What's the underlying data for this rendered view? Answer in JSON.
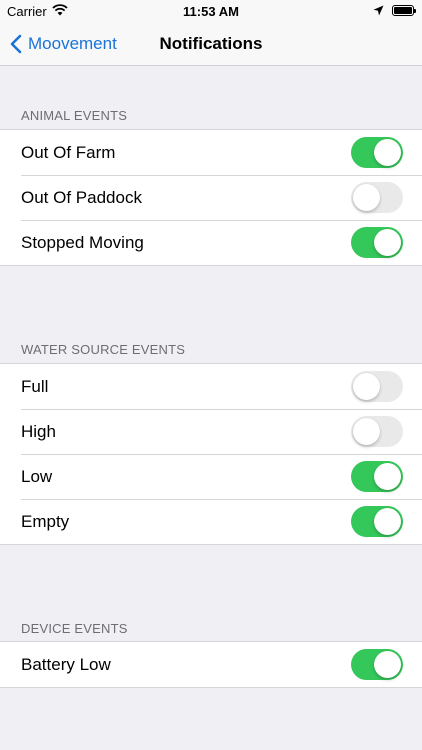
{
  "status_bar": {
    "carrier": "Carrier",
    "time": "11:53 AM",
    "wifi_icon": "wifi-icon",
    "location_icon": "location-arrow-icon",
    "battery_icon": "battery-icon"
  },
  "nav": {
    "back_label": "Moovement",
    "back_icon": "chevron-left-icon",
    "title": "Notifications",
    "accent": "#1a73d9"
  },
  "toggle_on_color": "#34c759",
  "sections": [
    {
      "header": "ANIMAL EVENTS",
      "rows": [
        {
          "label": "Out Of Farm",
          "on": true
        },
        {
          "label": "Out Of Paddock",
          "on": false
        },
        {
          "label": "Stopped Moving",
          "on": true
        }
      ]
    },
    {
      "header": "WATER SOURCE EVENTS",
      "rows": [
        {
          "label": "Full",
          "on": false
        },
        {
          "label": "High",
          "on": false
        },
        {
          "label": "Low",
          "on": true
        },
        {
          "label": "Empty",
          "on": true
        }
      ]
    },
    {
      "header": "DEVICE EVENTS",
      "rows": [
        {
          "label": "Battery Low",
          "on": true
        }
      ]
    }
  ]
}
